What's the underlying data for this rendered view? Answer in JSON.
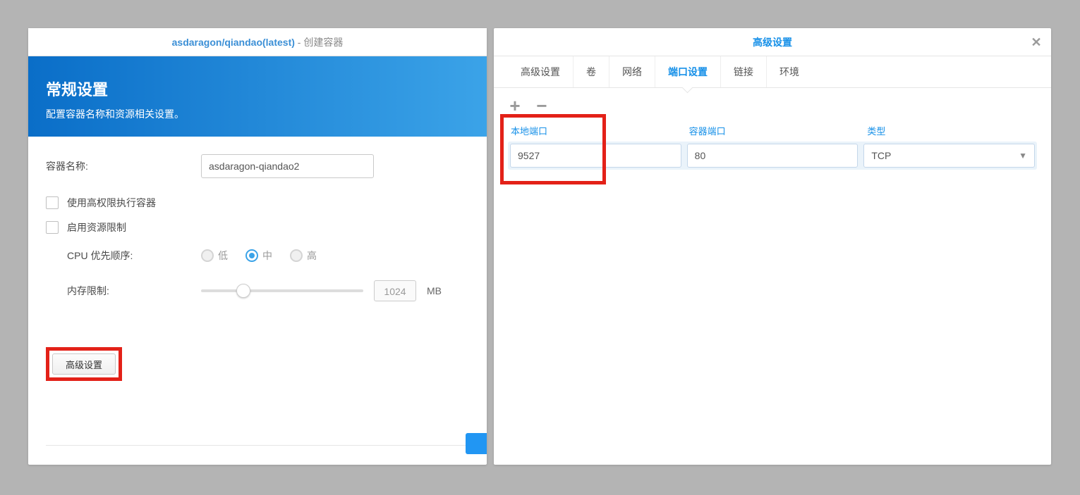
{
  "left": {
    "title_main": "asdaragon/qiandao(latest)",
    "title_suffix": " - 创建容器",
    "banner_heading": "常规设置",
    "banner_sub": "配置容器名称和资源相关设置。",
    "container_name_label": "容器名称:",
    "container_name_value": "asdaragon-qiandao2",
    "chk_privileged": "使用高权限执行容器",
    "chk_resource_limit": "启用资源限制",
    "cpu_priority_label": "CPU 优先顺序:",
    "cpu_options": {
      "low": "低",
      "mid": "中",
      "high": "高"
    },
    "cpu_selected": "mid",
    "mem_limit_label": "内存限制:",
    "mem_limit_value": "1024",
    "mem_unit": "MB",
    "adv_button": "高级设置"
  },
  "right": {
    "title": "高级设置",
    "tabs": {
      "adv": "高级设置",
      "vol": "卷",
      "net": "网络",
      "port": "端口设置",
      "link": "链接",
      "env": "环境"
    },
    "active_tab": "port",
    "cols": {
      "local": "本地端口",
      "container": "容器端口",
      "type": "类型"
    },
    "row": {
      "local": "9527",
      "container": "80",
      "type": "TCP"
    }
  }
}
